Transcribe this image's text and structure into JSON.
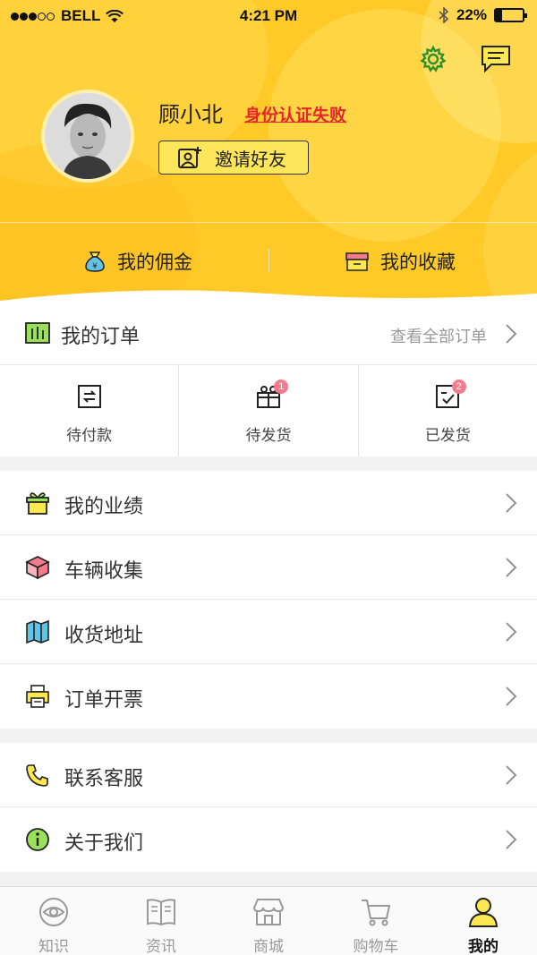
{
  "status_bar": {
    "carrier": "BELL",
    "time": "4:21 PM",
    "battery": "22%"
  },
  "profile": {
    "name": "顾小北",
    "auth_status": "身份认证失败",
    "invite_label": "邀请好友"
  },
  "header_links": {
    "commission": "我的佣金",
    "favorites": "我的收藏"
  },
  "orders": {
    "title": "我的订单",
    "view_all": "查看全部订单",
    "items": [
      {
        "label": "待付款",
        "badge": ""
      },
      {
        "label": "待发货",
        "badge": "1"
      },
      {
        "label": "已发货",
        "badge": "2"
      }
    ]
  },
  "menu_group_1": [
    {
      "label": "我的业绩",
      "icon": "gift-icon"
    },
    {
      "label": "车辆收集",
      "icon": "box-icon"
    },
    {
      "label": "收货地址",
      "icon": "map-icon"
    },
    {
      "label": "订单开票",
      "icon": "printer-icon"
    }
  ],
  "menu_group_2": [
    {
      "label": "联系客服",
      "icon": "phone-icon"
    },
    {
      "label": "关于我们",
      "icon": "info-icon"
    }
  ],
  "tabbar": [
    {
      "label": "知识",
      "icon": "eye-icon",
      "active": false
    },
    {
      "label": "资讯",
      "icon": "book-icon",
      "active": false
    },
    {
      "label": "商城",
      "icon": "store-icon",
      "active": false
    },
    {
      "label": "购物车",
      "icon": "cart-icon",
      "active": false
    },
    {
      "label": "我的",
      "icon": "user-icon",
      "active": true
    }
  ],
  "colors": {
    "brand_yellow": "#ffc928",
    "alert_red": "#e3262c",
    "badge_pink": "#f47a8c"
  }
}
